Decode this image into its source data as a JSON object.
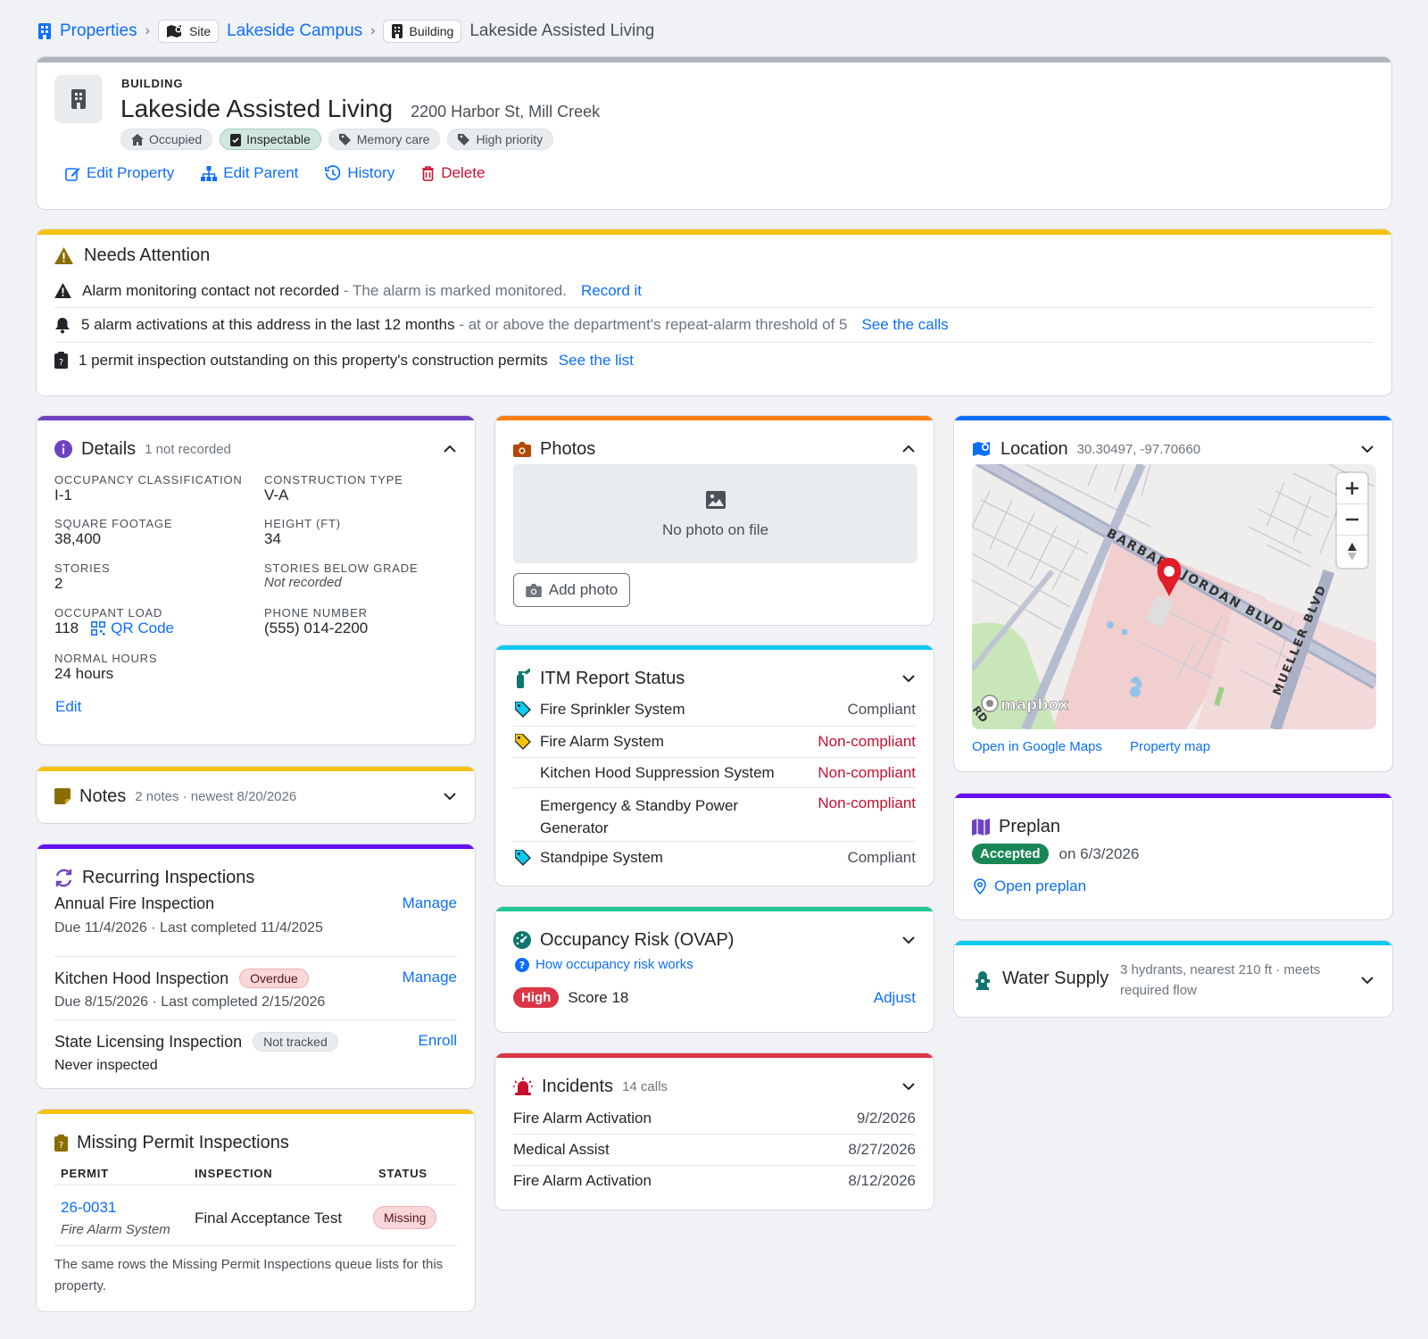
{
  "breadcrumb": {
    "root": "Properties",
    "site_chip": "Site",
    "site": "Lakeside Campus",
    "building_chip": "Building",
    "current": "Lakeside Assisted Living"
  },
  "header": {
    "type_label": "BUILDING",
    "name": "Lakeside Assisted Living",
    "address": "2200 Harbor St, Mill Creek",
    "tags": [
      "Occupied",
      "Inspectable",
      "Memory care",
      "High priority"
    ],
    "actions": {
      "edit": "Edit Property",
      "parent": "Edit Parent",
      "history": "History",
      "delete": "Delete"
    }
  },
  "attention": {
    "title": "Needs Attention",
    "items": [
      {
        "main": "Alarm monitoring contact not recorded",
        "detail": " - The alarm is marked monitored.",
        "link": "Record it"
      },
      {
        "main": "5 alarm activations at this address in the last 12 months",
        "detail": " - at or above the department's repeat-alarm threshold of 5",
        "link": "See the calls"
      },
      {
        "main": "1 permit inspection outstanding on this property's construction permits",
        "detail": "",
        "link": "See the list"
      }
    ]
  },
  "details": {
    "title": "Details",
    "sub": "1 not recorded",
    "fields": {
      "occupancy_label": "OCCUPANCY CLASSIFICATION",
      "occupancy": "I-1",
      "construction_label": "CONSTRUCTION TYPE",
      "construction": "V-A",
      "sqft_label": "SQUARE FOOTAGE",
      "sqft": "38,400",
      "height_label": "HEIGHT (FT)",
      "height": "34",
      "stories_label": "STORIES",
      "stories": "2",
      "below_label": "STORIES BELOW GRADE",
      "below": "Not recorded",
      "load_label": "OCCUPANT LOAD",
      "load": "118",
      "qr": "QR Code",
      "phone_label": "PHONE NUMBER",
      "phone": "(555) 014-2200",
      "hours_label": "NORMAL HOURS",
      "hours": "24 hours"
    },
    "edit": "Edit"
  },
  "notes": {
    "title": "Notes",
    "sub": "2 notes · newest 8/20/2026"
  },
  "recurring": {
    "title": "Recurring Inspections",
    "items": [
      {
        "name": "Annual Fire Inspection",
        "badge": "",
        "action": "Manage",
        "sub": "Due 11/4/2026 · Last completed 11/4/2025"
      },
      {
        "name": "Kitchen Hood Inspection",
        "badge": "Overdue",
        "action": "Manage",
        "sub": "Due 8/15/2026 · Last completed 2/15/2026"
      },
      {
        "name": "State Licensing Inspection",
        "badge": "Not tracked",
        "action": "Enroll",
        "sub": "Never inspected"
      }
    ]
  },
  "missing": {
    "title": "Missing Permit Inspections",
    "cols": [
      "PERMIT",
      "INSPECTION",
      "STATUS"
    ],
    "row": {
      "permit": "26-0031",
      "system": "Fire Alarm System",
      "inspection": "Final Acceptance Test",
      "status": "Missing"
    },
    "footer": "The same rows the Missing Permit Inspections queue lists for this property."
  },
  "photos": {
    "title": "Photos",
    "empty": "No photo on file",
    "add": "Add photo"
  },
  "itm": {
    "title": "ITM Report Status",
    "rows": [
      {
        "name": "Fire Sprinkler System",
        "status": "Compliant",
        "tag": "blue"
      },
      {
        "name": "Fire Alarm System",
        "status": "Non-compliant",
        "tag": "yellow"
      },
      {
        "name": "Kitchen Hood Suppression System",
        "status": "Non-compliant",
        "tag": ""
      },
      {
        "name": "Emergency & Standby Power Generator",
        "status": "Non-compliant",
        "tag": ""
      },
      {
        "name": "Standpipe System",
        "status": "Compliant",
        "tag": "blue"
      }
    ]
  },
  "ovap": {
    "title": "Occupancy Risk (OVAP)",
    "help": "How occupancy risk works",
    "level": "High",
    "score": "Score 18",
    "adjust": "Adjust"
  },
  "incidents": {
    "title": "Incidents",
    "sub": "14 calls",
    "rows": [
      {
        "type": "Fire Alarm Activation",
        "date": "9/2/2026"
      },
      {
        "type": "Medical Assist",
        "date": "8/27/2026"
      },
      {
        "type": "Fire Alarm Activation",
        "date": "8/12/2026"
      }
    ]
  },
  "location": {
    "title": "Location",
    "coords": "30.30497, -97.70660",
    "street1": "BARBARA JORDAN BLVD",
    "street2": "MUELLER BLVD",
    "street3": "RD",
    "attribution": "mapbox",
    "gmaps": "Open in Google Maps",
    "propmap": "Property map"
  },
  "preplan": {
    "title": "Preplan",
    "status": "Accepted",
    "date": "on 6/3/2026",
    "open": "Open preplan"
  },
  "water": {
    "title": "Water Supply",
    "sub": "3 hydrants, nearest 210 ft · meets required flow"
  },
  "colors": {
    "primary": "#0d6efd",
    "danger": "#c8102e",
    "warning": "#f5c211",
    "purple": "#6f42c1",
    "orange": "#fd7e14",
    "cyan": "#0dcaf0",
    "teal": "#20c997",
    "red": "#dc3545",
    "blue": "#0d6efd"
  }
}
